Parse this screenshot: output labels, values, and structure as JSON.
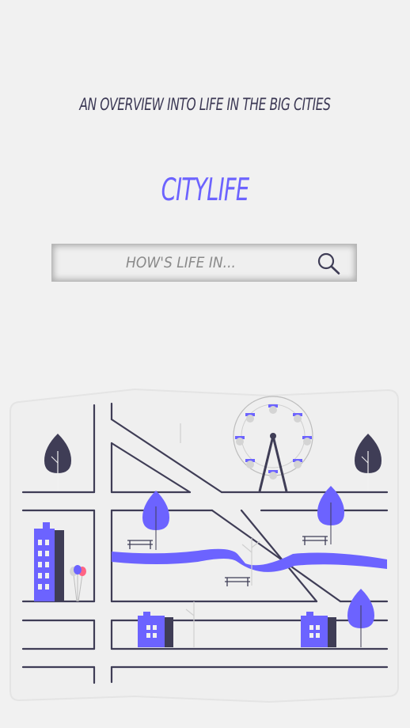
{
  "header": {
    "tagline": "AN OVERVIEW INTO LIFE IN THE BIG CITIES",
    "brand": "CITYLIFE"
  },
  "search": {
    "placeholder": "HOW'S LIFE IN...",
    "value": "",
    "icon": "search-icon"
  },
  "colors": {
    "background": "#f1f1f1",
    "accent": "#6c63ff",
    "dark": "#3f3d56"
  }
}
